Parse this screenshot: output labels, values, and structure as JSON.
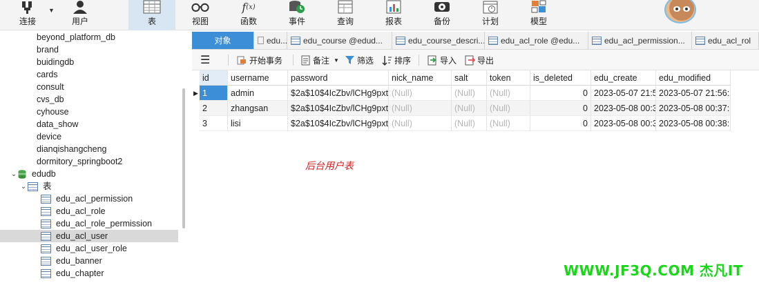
{
  "toolbar": {
    "buttons": [
      {
        "label": "连接",
        "icon": "connection-icon"
      },
      {
        "label": "用户",
        "icon": "user-icon"
      },
      {
        "label": "表",
        "icon": "table-icon"
      },
      {
        "label": "视图",
        "icon": "view-glasses-icon"
      },
      {
        "label": "函数",
        "icon": "function-icon"
      },
      {
        "label": "事件",
        "icon": "event-clock-icon"
      },
      {
        "label": "查询",
        "icon": "query-icon"
      },
      {
        "label": "报表",
        "icon": "report-icon"
      },
      {
        "label": "备份",
        "icon": "backup-icon"
      },
      {
        "label": "计划",
        "icon": "schedule-icon"
      },
      {
        "label": "模型",
        "icon": "model-icon"
      }
    ],
    "active": "表"
  },
  "tree": {
    "items": [
      {
        "label": "beyond_platform_db",
        "type": "db"
      },
      {
        "label": "brand",
        "type": "db"
      },
      {
        "label": "buidingdb",
        "type": "db"
      },
      {
        "label": "cards",
        "type": "db"
      },
      {
        "label": "consult",
        "type": "db"
      },
      {
        "label": "cvs_db",
        "type": "db"
      },
      {
        "label": "cyhouse",
        "type": "db"
      },
      {
        "label": "data_show",
        "type": "db"
      },
      {
        "label": "device",
        "type": "db"
      },
      {
        "label": "dianqishangcheng",
        "type": "db"
      },
      {
        "label": "dormitory_springboot2",
        "type": "db"
      },
      {
        "label": "edudb",
        "type": "db-open"
      },
      {
        "label": "表",
        "type": "folder"
      },
      {
        "label": "edu_acl_permission",
        "type": "table"
      },
      {
        "label": "edu_acl_role",
        "type": "table"
      },
      {
        "label": "edu_acl_role_permission",
        "type": "table"
      },
      {
        "label": "edu_acl_user",
        "type": "table",
        "selected": true
      },
      {
        "label": "edu_acl_user_role",
        "type": "table"
      },
      {
        "label": "edu_banner",
        "type": "table"
      },
      {
        "label": "edu_chapter",
        "type": "table"
      }
    ]
  },
  "tabs": [
    {
      "label": "对象",
      "active": true
    },
    {
      "label": "edu...",
      "icon": "leaf"
    },
    {
      "label": "edu_course @edud...",
      "icon": "table"
    },
    {
      "label": "edu_course_descri...",
      "icon": "table"
    },
    {
      "label": "edu_acl_role @edu...",
      "icon": "table"
    },
    {
      "label": "edu_acl_permission...",
      "icon": "table"
    },
    {
      "label": "edu_acl_rol",
      "icon": "table"
    }
  ],
  "actions": {
    "begin_tx": "开始事务",
    "note": "备注",
    "filter": "筛选",
    "sort": "排序",
    "import": "导入",
    "export": "导出"
  },
  "grid": {
    "columns": [
      "id",
      "username",
      "password",
      "nick_name",
      "salt",
      "token",
      "is_deleted",
      "edu_create",
      "edu_modified"
    ],
    "rows": [
      [
        "1",
        "admin",
        "$2a$10$4IcZbv/lCHg9pxt",
        "(Null)",
        "(Null)",
        "(Null)",
        "0",
        "2023-05-07 21:5",
        "2023-05-07 21:56:2"
      ],
      [
        "2",
        "zhangsan",
        "$2a$10$4IcZbv/lCHg9pxt",
        "(Null)",
        "(Null)",
        "(Null)",
        "0",
        "2023-05-08 00:3",
        "2023-05-08 00:37:1"
      ],
      [
        "3",
        "lisi",
        "$2a$10$4IcZbv/lCHg9pxt",
        "(Null)",
        "(Null)",
        "(Null)",
        "0",
        "2023-05-08 00:3",
        "2023-05-08 00:38:1"
      ]
    ]
  },
  "annotation": "后台用户表",
  "watermark": "WWW.JF3Q.COM 杰凡IT",
  "colors": {
    "accent": "#3c8fd6",
    "annotation": "#d62020",
    "watermark": "#19d619"
  }
}
